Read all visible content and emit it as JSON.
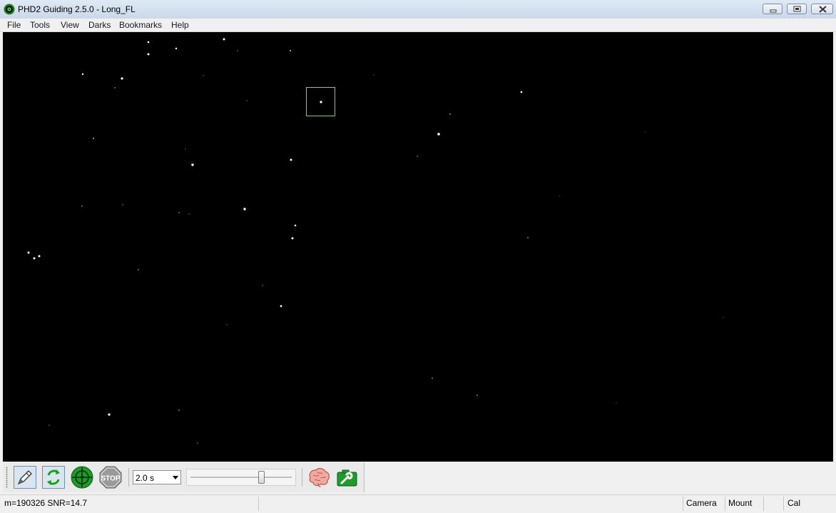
{
  "window": {
    "title": "PHD2 Guiding 2.5.0 - Long_FL",
    "app_icon": "phd2-eye-icon",
    "controls": [
      "minimize-icon",
      "maximize-icon",
      "close-icon"
    ]
  },
  "menu": {
    "file": "File",
    "tools": "Tools",
    "view": "View",
    "darks": "Darks",
    "bookmarks": "Bookmarks",
    "help": "Help"
  },
  "viewport": {
    "background": "#000000",
    "star_color": "#ffffff",
    "selection_box_color": "#7cd36a"
  },
  "toolbar": {
    "icons": {
      "loop": "loop-exposure-icon",
      "auto_select": "auto-select-star-icon",
      "guide": "guide-crosshair-icon",
      "stop": "stop-sign-icon",
      "brain": "brain-icon",
      "settings": "camera-settings-icon"
    },
    "stop_label": "STOP",
    "exposure": "2.0 s",
    "gamma_level": 0.7
  },
  "status": {
    "star_info": "m=190326 SNR=14.7",
    "camera": "Camera",
    "mount": "Mount",
    "cal": "Cal"
  }
}
